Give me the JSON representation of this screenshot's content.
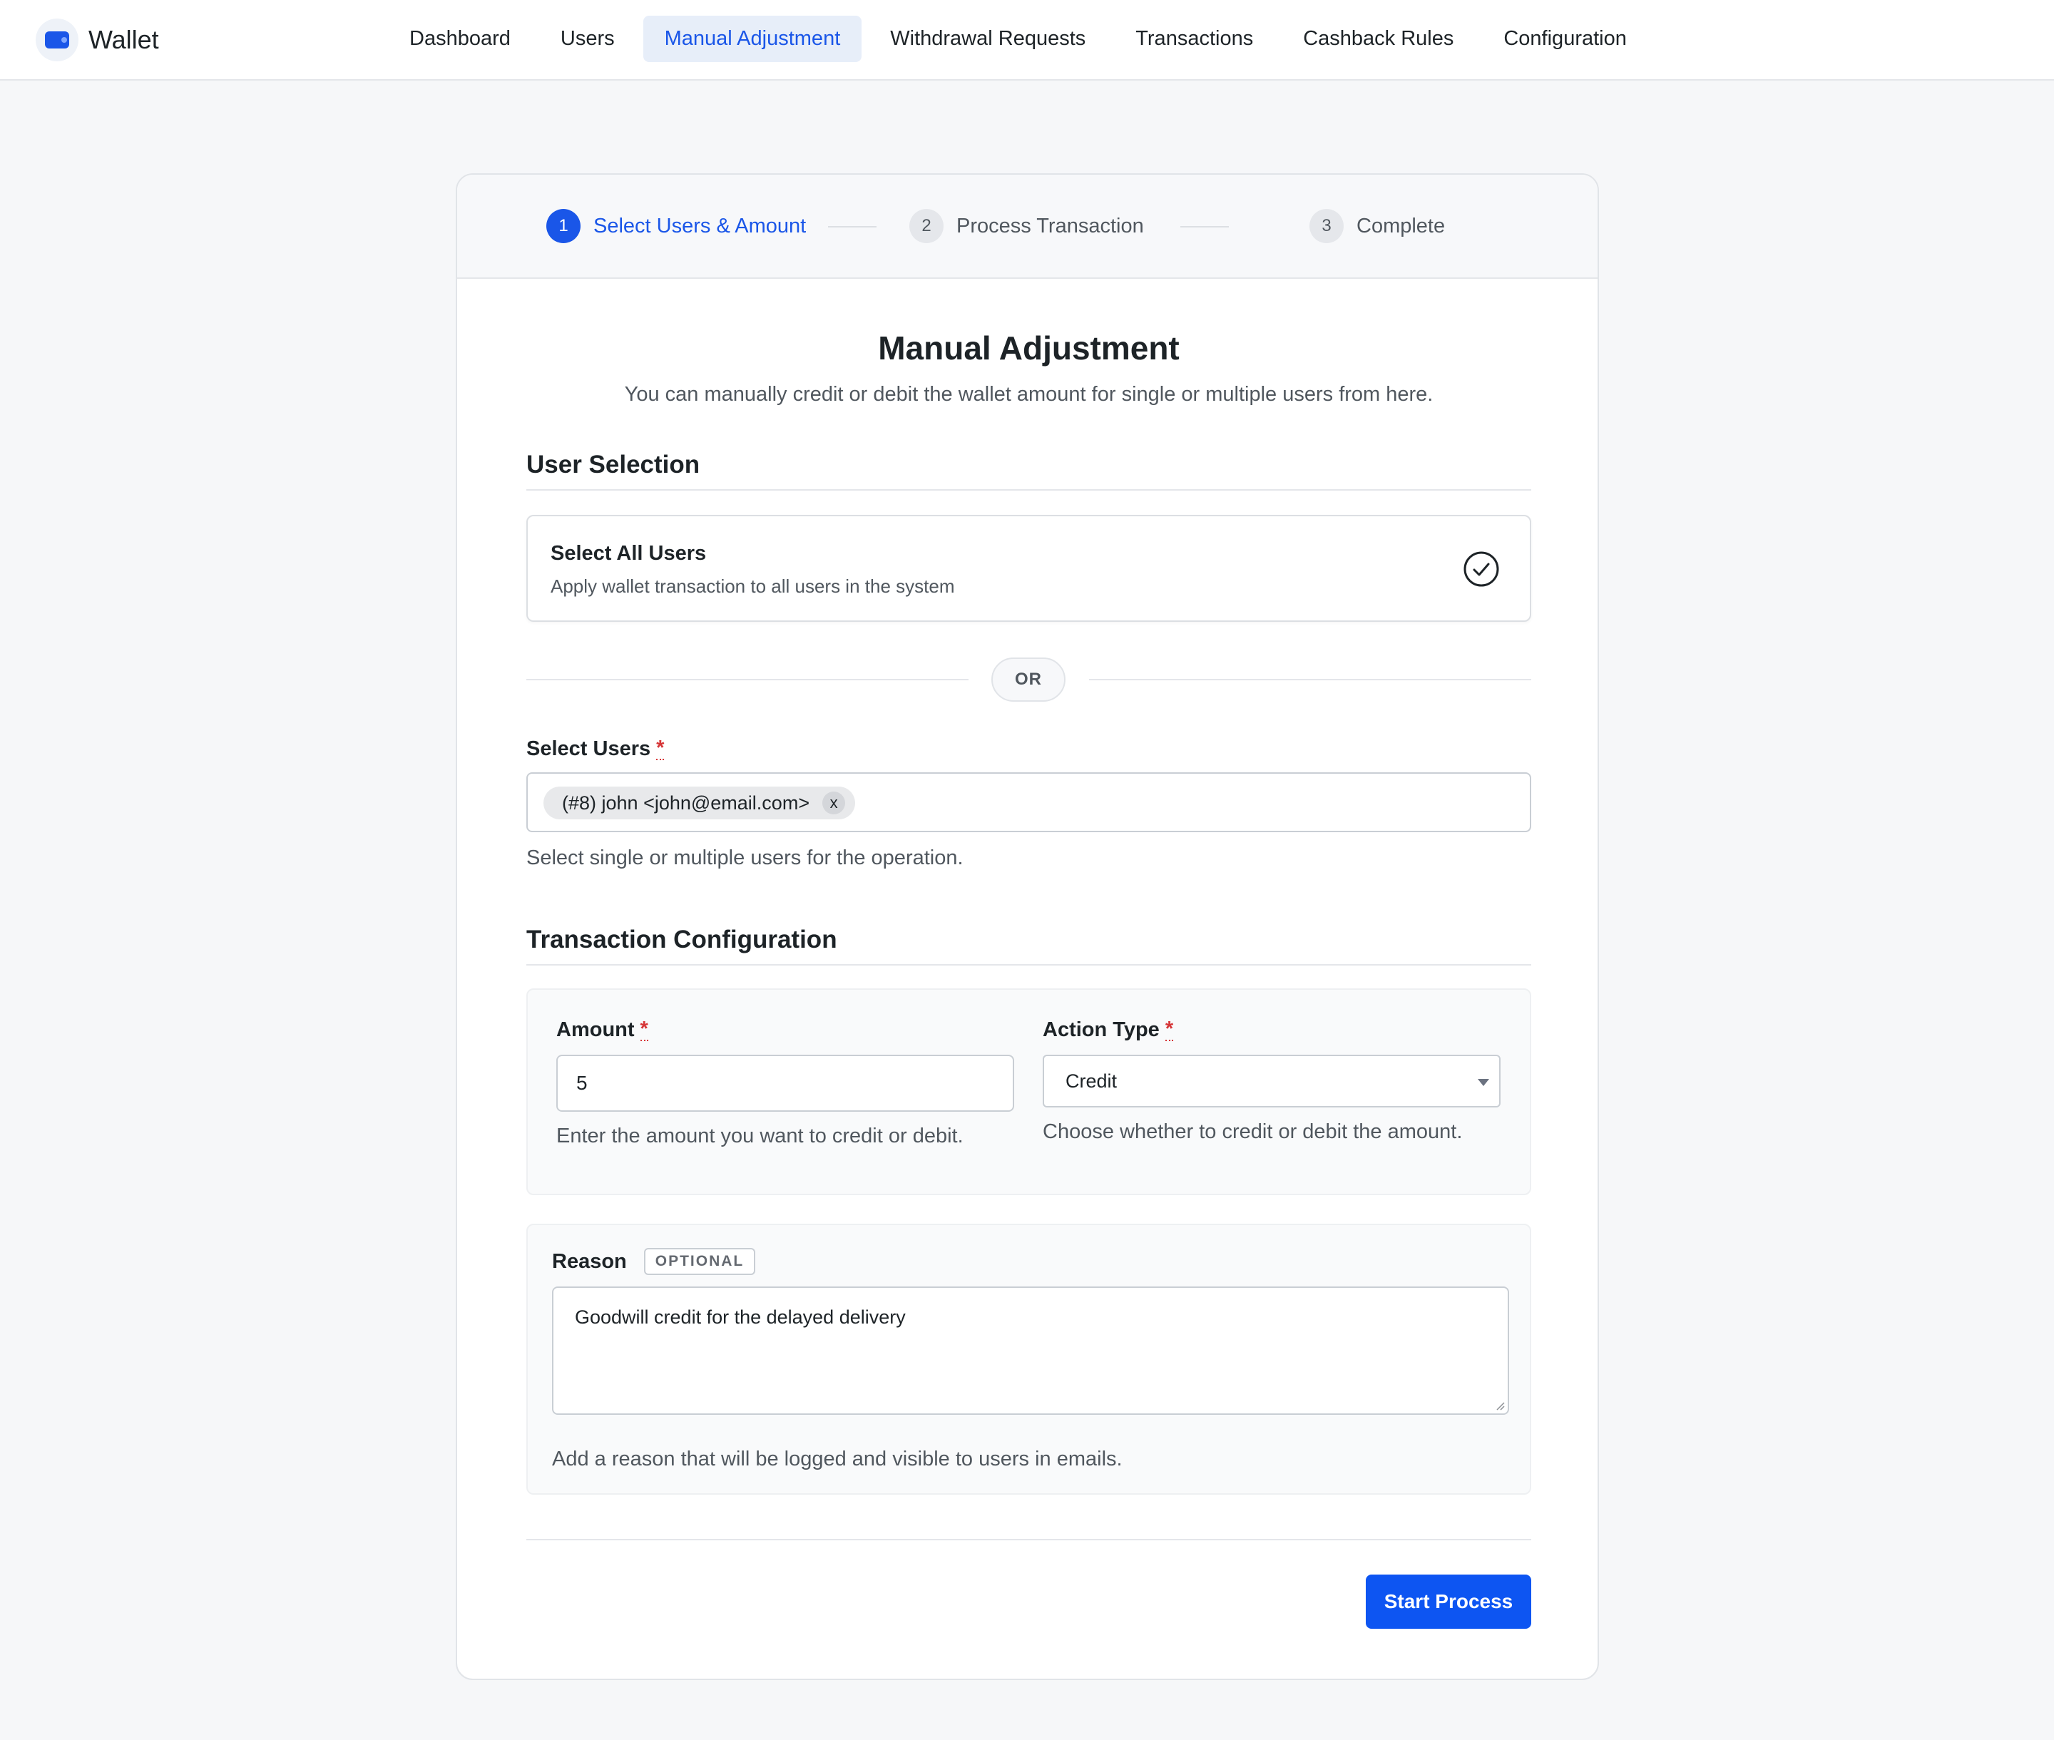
{
  "app": {
    "name": "Wallet",
    "logo_icon": "wallet-icon",
    "accent_color": "#1a56e8"
  },
  "nav": {
    "items": [
      {
        "label": "Dashboard",
        "active": false
      },
      {
        "label": "Users",
        "active": false
      },
      {
        "label": "Manual Adjustment",
        "active": true
      },
      {
        "label": "Withdrawal Requests",
        "active": false
      },
      {
        "label": "Transactions",
        "active": false
      },
      {
        "label": "Cashback Rules",
        "active": false
      },
      {
        "label": "Configuration",
        "active": false
      }
    ]
  },
  "stepper": {
    "steps": [
      {
        "number": "1",
        "label": "Select Users & Amount",
        "active": true
      },
      {
        "number": "2",
        "label": "Process Transaction",
        "active": false
      },
      {
        "number": "3",
        "label": "Complete",
        "active": false
      }
    ]
  },
  "page": {
    "title": "Manual Adjustment",
    "subtitle": "You can manually credit or debit the wallet amount for single or multiple users from here."
  },
  "user_selection": {
    "heading": "User Selection",
    "select_all": {
      "title": "Select All Users",
      "description": "Apply wallet transaction to all users in the system",
      "icon": "check-circle-icon"
    },
    "or_label": "OR",
    "select_users": {
      "label": "Select Users",
      "required_mark": "*",
      "selected": [
        {
          "label": "(#8) john <john@email.com>",
          "remove_label": "x"
        }
      ],
      "help": "Select single or multiple users for the operation."
    }
  },
  "transaction_config": {
    "heading": "Transaction Configuration",
    "amount": {
      "label": "Amount",
      "required_mark": "*",
      "value": "5",
      "help": "Enter the amount you want to credit or debit."
    },
    "action_type": {
      "label": "Action Type",
      "required_mark": "*",
      "value": "Credit",
      "help": "Choose whether to credit or debit the amount."
    },
    "reason": {
      "label": "Reason",
      "badge": "OPTIONAL",
      "value": "Goodwill credit for the delayed delivery",
      "help": "Add a reason that will be logged and visible to users in emails."
    }
  },
  "actions": {
    "primary_label": "Start Process",
    "primary_color": "#0d55f2"
  }
}
